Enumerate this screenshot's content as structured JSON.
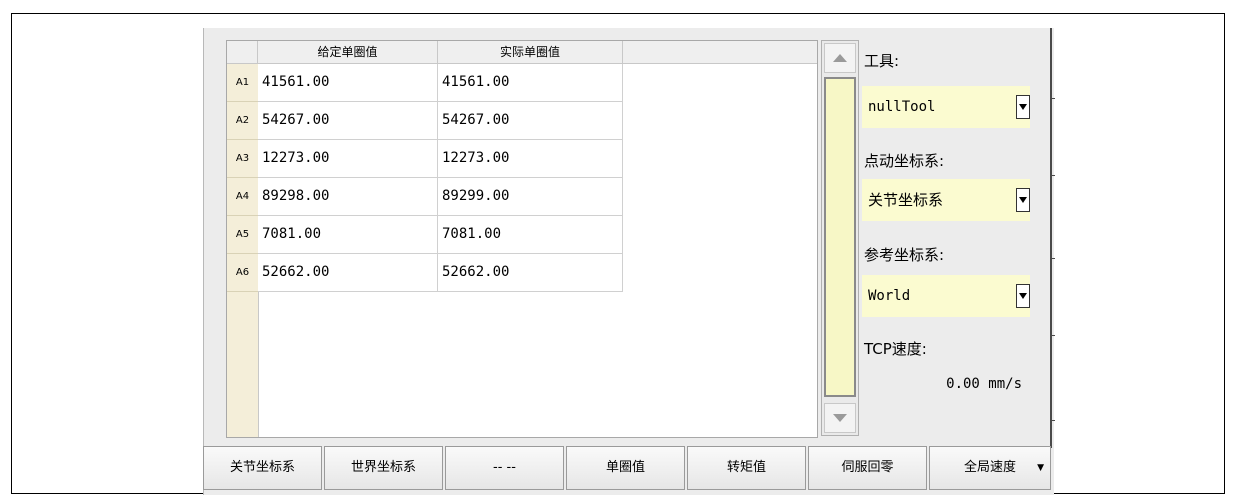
{
  "table": {
    "headers": [
      "",
      "给定单圈值",
      "实际单圈值",
      ""
    ],
    "rows": [
      {
        "id": "A1",
        "given": "41561.00",
        "actual": "41561.00"
      },
      {
        "id": "A2",
        "given": "54267.00",
        "actual": "54267.00"
      },
      {
        "id": "A3",
        "given": "12273.00",
        "actual": "12273.00"
      },
      {
        "id": "A4",
        "given": "89298.00",
        "actual": "89299.00"
      },
      {
        "id": "A5",
        "given": "7081.00",
        "actual": "7081.00"
      },
      {
        "id": "A6",
        "given": "52662.00",
        "actual": "52662.00"
      }
    ]
  },
  "side": {
    "tool_label": "工具:",
    "tool_value": "nullTool",
    "jog_label": "点动坐标系:",
    "jog_value": "关节坐标系",
    "ref_label": "参考坐标系:",
    "ref_value": "World",
    "tcp_label": "TCP速度:",
    "tcp_value": "0.00 mm/s"
  },
  "toolbar": {
    "buttons": [
      "关节坐标系",
      "世界坐标系",
      "-- --",
      "单圈值",
      "转矩值",
      "伺服回零",
      "全局速度"
    ]
  },
  "icons": {
    "scroll_up": "triangle-up-icon",
    "scroll_down": "triangle-down-icon",
    "dropdown": "triangle-down-icon",
    "menu_caret": "caret-down-icon"
  },
  "colors": {
    "combo_bg": "#fbfbd0",
    "row_header_bg": "#f4eed9",
    "scroll_thumb": "#f7f7c6"
  }
}
